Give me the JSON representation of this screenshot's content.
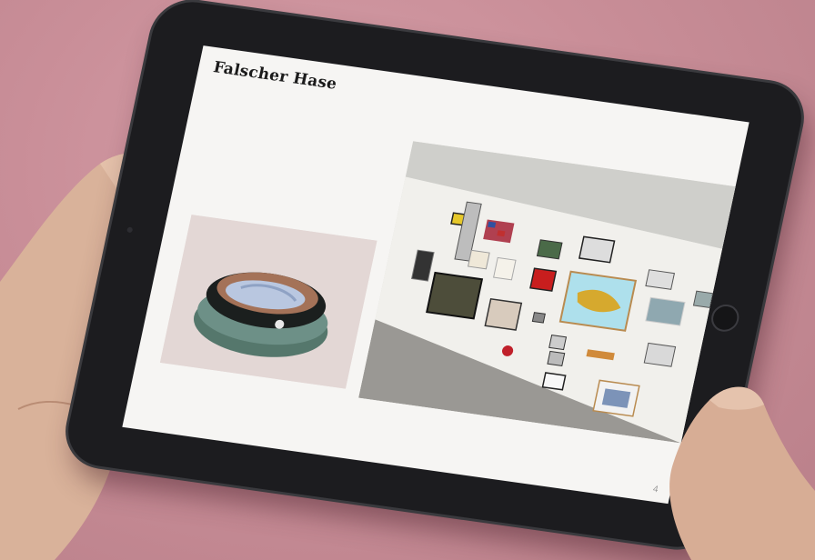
{
  "screen": {
    "title": "Falscher Hase",
    "page_number": "4"
  },
  "colors": {
    "wall": "#c88f99",
    "tablet_bezel": "#1c1c1f",
    "screen_background": "#f6f5f3"
  }
}
